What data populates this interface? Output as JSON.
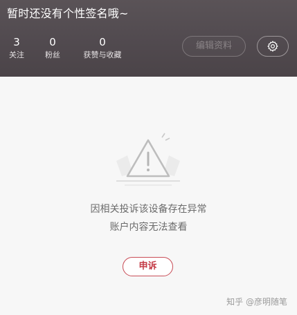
{
  "profile": {
    "signature": "暂时还没有个性签名哦~",
    "stats": [
      {
        "value": "3",
        "label": "关注"
      },
      {
        "value": "0",
        "label": "粉丝"
      },
      {
        "value": "0",
        "label": "获赞与收藏"
      }
    ],
    "edit_label": "编辑资料",
    "settings_icon": "gear-icon"
  },
  "notice": {
    "line1": "因相关投诉该设备存在异常",
    "line2": "账户内容无法查看",
    "icon": "warning-triangle-icon"
  },
  "appeal_label": "申诉",
  "watermark": "知乎 @彦明随笔",
  "colors": {
    "header_bg": "#534c51",
    "accent_red": "#c33a45",
    "content_bg": "#f7f7f7"
  }
}
